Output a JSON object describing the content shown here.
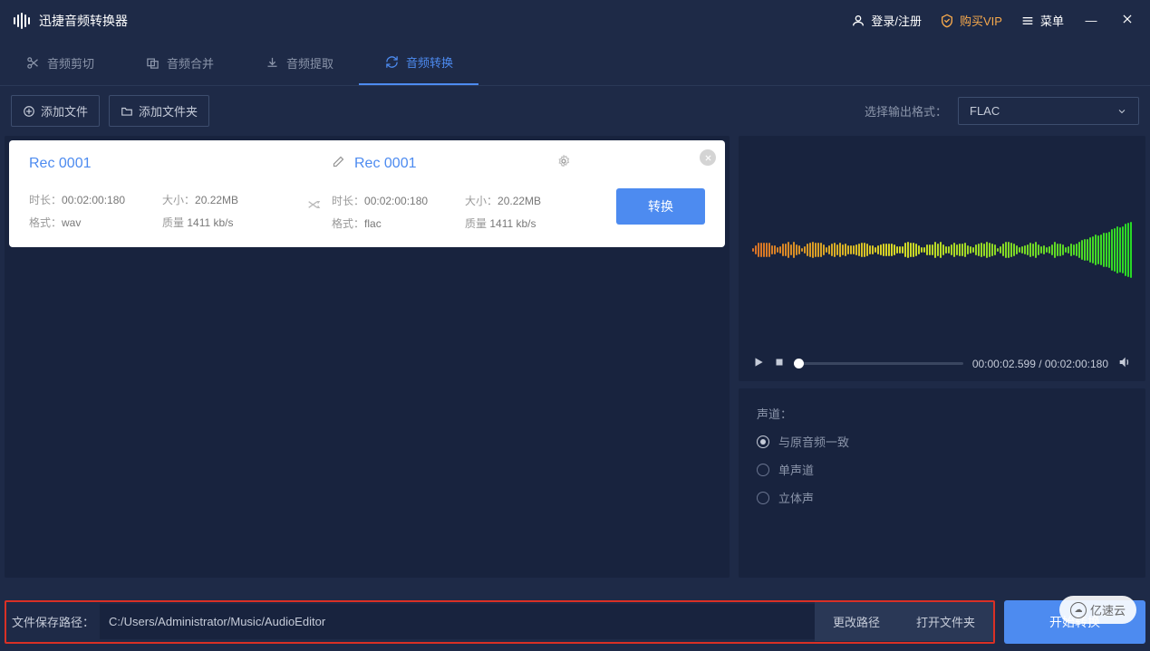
{
  "app_title": "迅捷音频转换器",
  "header": {
    "login": "登录/注册",
    "vip": "购买VIP",
    "menu": "菜单"
  },
  "tabs": [
    {
      "label": "音频剪切"
    },
    {
      "label": "音频合并"
    },
    {
      "label": "音频提取"
    },
    {
      "label": "音频转换"
    }
  ],
  "toolbar": {
    "add_file": "添加文件",
    "add_folder": "添加文件夹",
    "output_format_label": "选择输出格式：",
    "output_format_value": "FLAC"
  },
  "files": [
    {
      "source": {
        "name": "Rec 0001",
        "duration_label": "时长：",
        "duration": "00:02:00:180",
        "size_label": "大小：",
        "size": "20.22MB",
        "format_label": "格式：",
        "format": "wav",
        "quality_label": "质量",
        "quality": "1411 kb/s"
      },
      "target": {
        "name": "Rec 0001",
        "duration_label": "时长：",
        "duration": "00:02:00:180",
        "size_label": "大小：",
        "size": "20.22MB",
        "format_label": "格式：",
        "format": "flac",
        "quality_label": "质量",
        "quality": "1411 kb/s"
      },
      "convert_btn": "转换"
    }
  ],
  "player": {
    "current_time": "00:00:02.599",
    "separator": " / ",
    "total_time": "00:02:00:180"
  },
  "channel": {
    "title": "声道：",
    "options": [
      {
        "label": "与原音频一致",
        "checked": true
      },
      {
        "label": "单声道",
        "checked": false
      },
      {
        "label": "立体声",
        "checked": false
      }
    ]
  },
  "bottom": {
    "path_label": "文件保存路径：",
    "path_value": "C:/Users/Administrator/Music/AudioEditor",
    "change_path": "更改路径",
    "open_folder": "打开文件夹",
    "start_convert": "开始转换"
  },
  "watermark": "亿速云"
}
